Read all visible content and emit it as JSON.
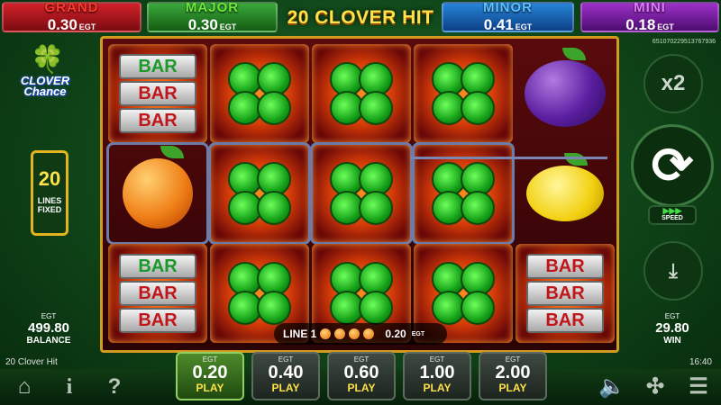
{
  "jackpots": {
    "grand": {
      "name": "GRAND",
      "value": "0.30",
      "currency": "EGT"
    },
    "major": {
      "name": "MAJOR",
      "value": "0.30",
      "currency": "EGT"
    },
    "minor": {
      "name": "MINOR",
      "value": "0.41",
      "currency": "EGT"
    },
    "mini": {
      "name": "MINI",
      "value": "0.18",
      "currency": "EGT"
    }
  },
  "title": "20 CLOVER HIT",
  "ticket_id": "651070229513767936",
  "logo": {
    "line1": "CLOVER",
    "line2": "Chance"
  },
  "lines": {
    "count": "20",
    "label1": "LINES",
    "label2": "FIXED"
  },
  "balance": {
    "currency": "EGT",
    "amount": "499.80",
    "label": "BALANCE"
  },
  "reels": [
    [
      "bar",
      "clover",
      "clover",
      "clover",
      "plum"
    ],
    [
      "orange",
      "clover",
      "clover",
      "clover",
      "lemon"
    ],
    [
      "bar",
      "clover",
      "clover",
      "clover",
      "bar"
    ]
  ],
  "bar_text": "BAR",
  "line_info": {
    "label": "LINE 1",
    "amount": "0.20",
    "currency": "EGT"
  },
  "multiplier": "x2",
  "speed_label": "SPEED",
  "win": {
    "currency": "EGT",
    "amount": "29.80",
    "label": "WIN"
  },
  "game_name": "20 Clover Hit",
  "clock": "16:40",
  "bets": [
    {
      "currency": "EGT",
      "value": "0.20",
      "label": "PLAY",
      "active": true
    },
    {
      "currency": "EGT",
      "value": "0.40",
      "label": "PLAY",
      "active": false
    },
    {
      "currency": "EGT",
      "value": "0.60",
      "label": "PLAY",
      "active": false
    },
    {
      "currency": "EGT",
      "value": "1.00",
      "label": "PLAY",
      "active": false
    },
    {
      "currency": "EGT",
      "value": "2.00",
      "label": "PLAY",
      "active": false
    }
  ],
  "icons": {
    "home": "home-icon",
    "info": "info-icon",
    "help": "help-icon",
    "sound": "sound-icon",
    "fullscreen": "fullscreen-icon",
    "menu": "menu-icon",
    "spin": "spin-icon",
    "autoplay": "autoplay-icon"
  }
}
